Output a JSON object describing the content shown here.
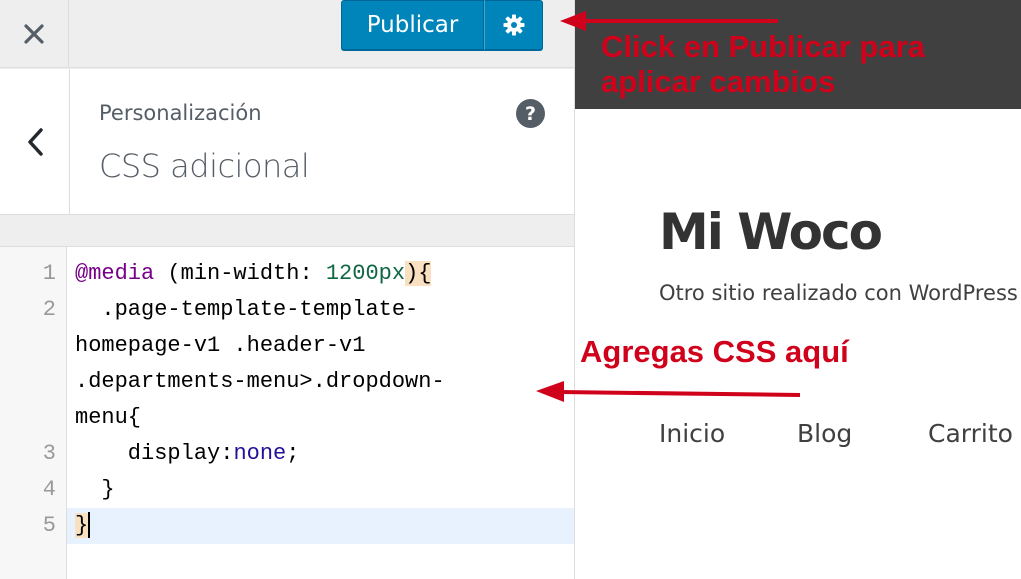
{
  "toolbar": {
    "close_icon": "close-icon",
    "publish_label": "Publicar",
    "settings_icon": "gear-icon",
    "accent_color": "#0085ba"
  },
  "section": {
    "back_icon": "chevron-left-icon",
    "breadcrumb": "Personalización",
    "title": "CSS adicional",
    "help_label": "?"
  },
  "editor": {
    "line_numbers": [
      "1",
      "2",
      "3",
      "4",
      "5"
    ],
    "lines": {
      "l1_at": "@media",
      "l1_cond_open": " (min-width: ",
      "l1_value": "1200px",
      "l1_cond_close": ")",
      "l1_brace": "{",
      "l2a": "  .page-template-template-",
      "l2b": "homepage-v1 .header-v1",
      "l2c": ".departments-menu>.dropdown-",
      "l2d": "menu{",
      "l3_prop": "    display:",
      "l3_value": "none",
      "l3_end": ";",
      "l4": "  }",
      "l5": "}"
    }
  },
  "preview": {
    "site_title": "Mi Woco",
    "tagline": "Otro sitio realizado con WordPress",
    "nav": [
      "Inicio",
      "Blog",
      "Carrito"
    ]
  },
  "annotations": {
    "publish_line1": "Click en Publicar para",
    "publish_line2": "aplicar cambios",
    "css_here": "Agregas CSS aquí",
    "color": "#d0021b"
  }
}
